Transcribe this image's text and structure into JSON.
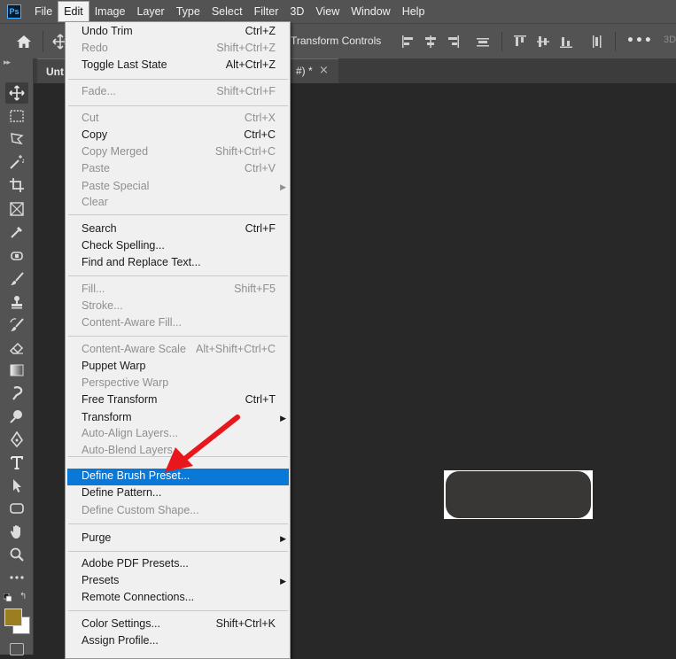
{
  "app": {
    "logo_text": "Ps"
  },
  "menubar": [
    "File",
    "Edit",
    "Image",
    "Layer",
    "Type",
    "Select",
    "Filter",
    "3D",
    "View",
    "Window",
    "Help"
  ],
  "options_bar": {
    "transform_controls": "Transform Controls",
    "mode_3d": "3D",
    "more": "•••"
  },
  "document": {
    "tab_left": "Unt",
    "tab_right": "#) *",
    "close": "×"
  },
  "edit_menu": {
    "items": [
      {
        "label": "Undo Trim",
        "shortcut": "Ctrl+Z",
        "enabled": true
      },
      {
        "label": "Redo",
        "shortcut": "Shift+Ctrl+Z",
        "enabled": false
      },
      {
        "label": "Toggle Last State",
        "shortcut": "Alt+Ctrl+Z",
        "enabled": true
      },
      {
        "label": "Fade...",
        "shortcut": "Shift+Ctrl+F",
        "enabled": false
      },
      {
        "label": "Cut",
        "shortcut": "Ctrl+X",
        "enabled": false
      },
      {
        "label": "Copy",
        "shortcut": "Ctrl+C",
        "enabled": true
      },
      {
        "label": "Copy Merged",
        "shortcut": "Shift+Ctrl+C",
        "enabled": false
      },
      {
        "label": "Paste",
        "shortcut": "Ctrl+V",
        "enabled": false
      },
      {
        "label": "Paste Special",
        "shortcut": "",
        "enabled": false,
        "submenu": true
      },
      {
        "label": "Clear",
        "shortcut": "",
        "enabled": false
      },
      {
        "label": "Search",
        "shortcut": "Ctrl+F",
        "enabled": true
      },
      {
        "label": "Check Spelling...",
        "shortcut": "",
        "enabled": true
      },
      {
        "label": "Find and Replace Text...",
        "shortcut": "",
        "enabled": true
      },
      {
        "label": "Fill...",
        "shortcut": "Shift+F5",
        "enabled": false
      },
      {
        "label": "Stroke...",
        "shortcut": "",
        "enabled": false
      },
      {
        "label": "Content-Aware Fill...",
        "shortcut": "",
        "enabled": false
      },
      {
        "label": "Content-Aware Scale",
        "shortcut": "Alt+Shift+Ctrl+C",
        "enabled": false
      },
      {
        "label": "Puppet Warp",
        "shortcut": "",
        "enabled": true
      },
      {
        "label": "Perspective Warp",
        "shortcut": "",
        "enabled": false
      },
      {
        "label": "Free Transform",
        "shortcut": "Ctrl+T",
        "enabled": true
      },
      {
        "label": "Transform",
        "shortcut": "",
        "enabled": true,
        "submenu": true
      },
      {
        "label": "Auto-Align Layers...",
        "shortcut": "",
        "enabled": false
      },
      {
        "label": "Auto-Blend Layers...",
        "shortcut": "",
        "enabled": false
      },
      {
        "label": "Define Brush Preset...",
        "shortcut": "",
        "enabled": true,
        "highlighted": true
      },
      {
        "label": "Define Pattern...",
        "shortcut": "",
        "enabled": true
      },
      {
        "label": "Define Custom Shape...",
        "shortcut": "",
        "enabled": false
      },
      {
        "label": "Purge",
        "shortcut": "",
        "enabled": true,
        "submenu": true
      },
      {
        "label": "Adobe PDF Presets...",
        "shortcut": "",
        "enabled": true
      },
      {
        "label": "Presets",
        "shortcut": "",
        "enabled": true,
        "submenu": true
      },
      {
        "label": "Remote Connections...",
        "shortcut": "",
        "enabled": true
      },
      {
        "label": "Color Settings...",
        "shortcut": "Shift+Ctrl+K",
        "enabled": true
      },
      {
        "label": "Assign Profile...",
        "shortcut": "",
        "enabled": true
      }
    ]
  },
  "colors": {
    "accent": "#0a78d7",
    "foreground_swatch": "#9b7d22",
    "background_swatch": "#ffffff",
    "annotation_arrow": "#e8171b"
  }
}
